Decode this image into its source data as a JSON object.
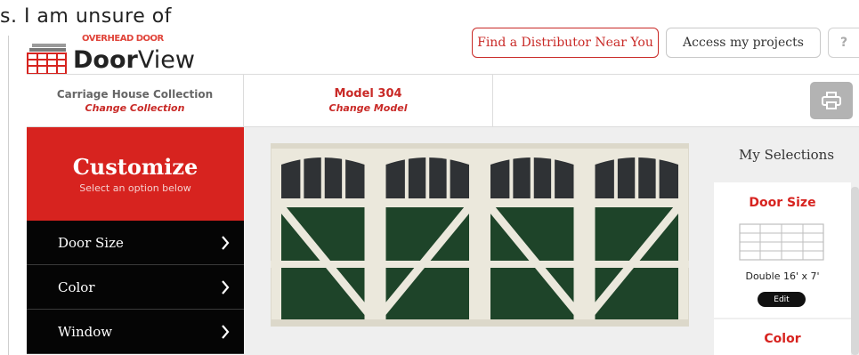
{
  "overlay_text": "s.  I am unsure of",
  "logo": {
    "badge": "OVERHEAD DOOR",
    "text_strong": "Door",
    "text_light": "View"
  },
  "header": {
    "distributor_label": "Find a Distributor Near You",
    "projects_label": "Access my projects",
    "help_label": "?"
  },
  "tabs": {
    "collection_title": "Carriage House Collection",
    "collection_action": "Change Collection",
    "model_title": "Model 304",
    "model_action": "Change Model",
    "print_icon": "printer-icon"
  },
  "customize": {
    "title": "Customize",
    "subtitle": "Select an option below"
  },
  "menu": [
    {
      "label": "Door Size",
      "icon": "chevron-right-icon"
    },
    {
      "label": "Color",
      "icon": "chevron-right-icon"
    },
    {
      "label": "Window",
      "icon": "chevron-right-icon"
    }
  ],
  "door_preview": {
    "frame_color": "#ebe8dc",
    "panel_color": "#1e4429",
    "window_color": "#2f3235",
    "sections": 4
  },
  "selections": {
    "heading": "My Selections",
    "door_size": {
      "title": "Door Size",
      "value": "Double 16' x 7'",
      "edit_label": "Edit"
    },
    "color": {
      "title": "Color"
    }
  },
  "colors": {
    "brand_red": "#d7231f",
    "menu_black": "#050505",
    "accent_red": "#c92a27"
  }
}
